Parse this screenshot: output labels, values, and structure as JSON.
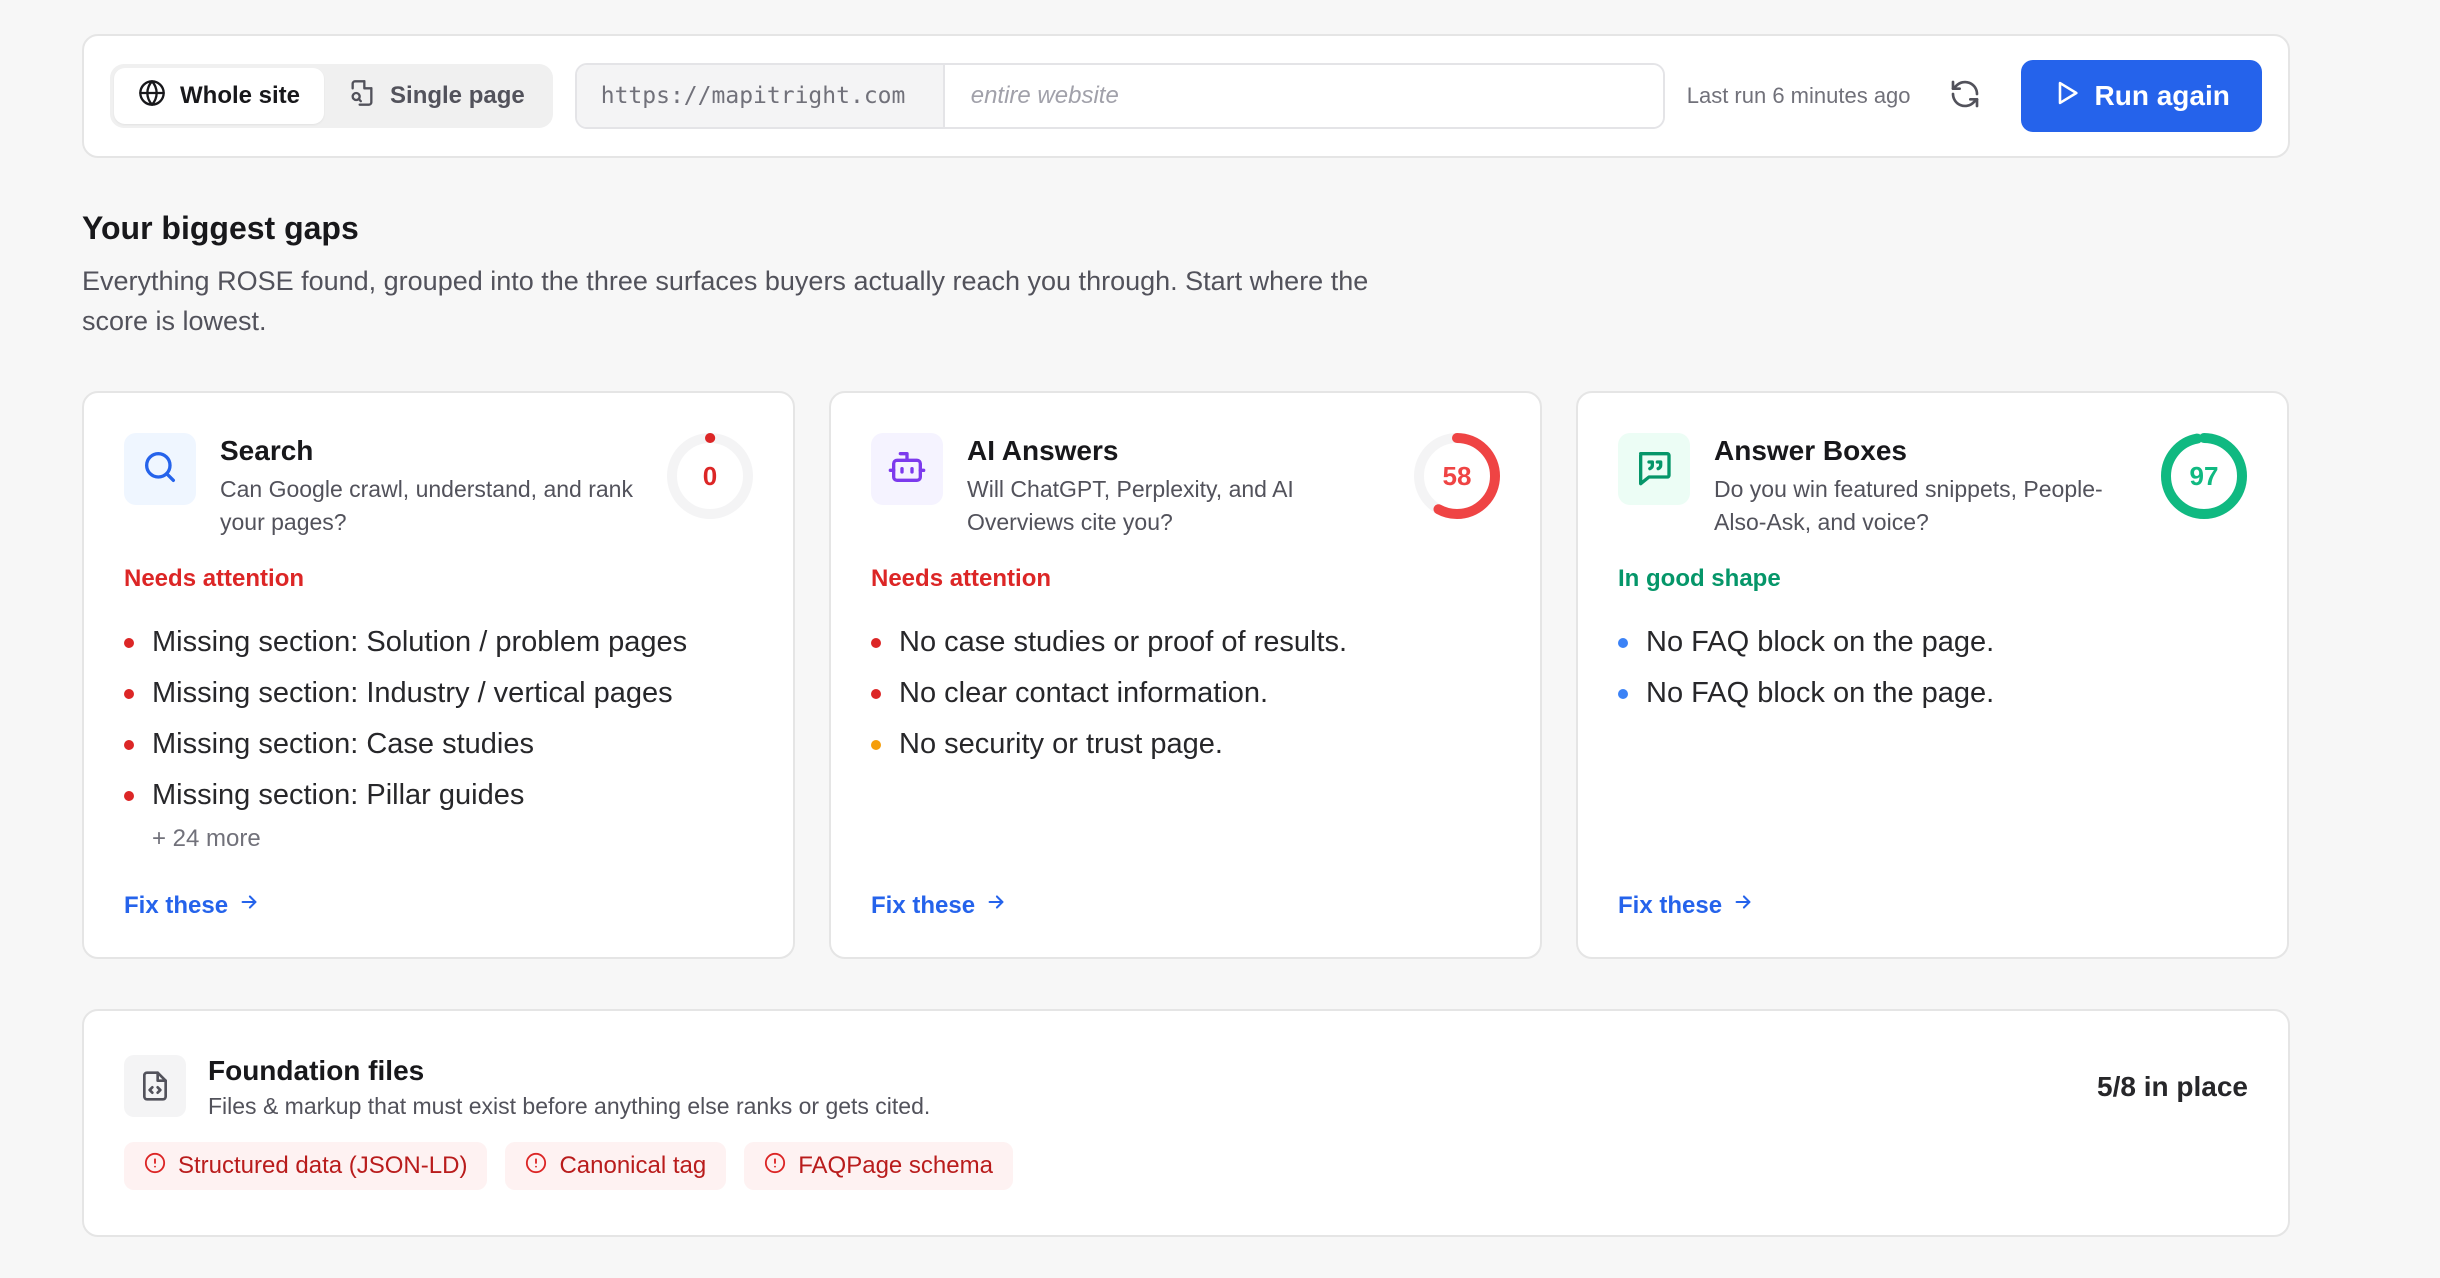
{
  "toolbar": {
    "scope_tabs": [
      {
        "label": "Whole site",
        "icon": "globe-icon",
        "active": true
      },
      {
        "label": "Single page",
        "icon": "file-search-icon",
        "active": false
      }
    ],
    "url_prefix": "https://mapitright.com",
    "url_placeholder": "entire website",
    "last_run": "Last run 6 minutes ago",
    "run_label": "Run again"
  },
  "gaps": {
    "title": "Your biggest gaps",
    "subtitle": "Everything ROSE found, grouped into the three surfaces buyers actually reach you through. Start where the score is lowest."
  },
  "cards": [
    {
      "title": "Search",
      "desc": "Can Google crawl, understand, and rank your pages?",
      "icon": "search-icon",
      "score": "0",
      "score_value": 0,
      "score_color": "#dc2626",
      "status": "Needs attention",
      "status_color": "#dc2626",
      "issues": [
        {
          "text": "Missing section: Solution / problem pages",
          "color": "#dc2626"
        },
        {
          "text": "Missing section: Industry / vertical pages",
          "color": "#dc2626"
        },
        {
          "text": "Missing section: Case studies",
          "color": "#dc2626"
        },
        {
          "text": "Missing section: Pillar guides",
          "color": "#dc2626"
        }
      ],
      "more": "+ 24 more",
      "fix_label": "Fix these"
    },
    {
      "title": "AI Answers",
      "desc": "Will ChatGPT, Perplexity, and AI Overviews cite you?",
      "icon": "bot-icon",
      "score": "58",
      "score_value": 58,
      "score_color": "#ef4444",
      "status": "Needs attention",
      "status_color": "#dc2626",
      "issues": [
        {
          "text": "No case studies or proof of results.",
          "color": "#dc2626"
        },
        {
          "text": "No clear contact information.",
          "color": "#dc2626"
        },
        {
          "text": "No security or trust page.",
          "color": "#f59e0b"
        }
      ],
      "more": "",
      "fix_label": "Fix these"
    },
    {
      "title": "Answer Boxes",
      "desc": "Do you win featured snippets, People-Also-Ask, and voice?",
      "icon": "quote-message-icon",
      "score": "97",
      "score_value": 97,
      "score_color": "#10b981",
      "status": "In good shape",
      "status_color": "#059669",
      "issues": [
        {
          "text": "No FAQ block on the page.",
          "color": "#3b82f6"
        },
        {
          "text": "No FAQ block on the page.",
          "color": "#3b82f6"
        }
      ],
      "more": "",
      "fix_label": "Fix these"
    }
  ],
  "foundation": {
    "title": "Foundation files",
    "desc": "Files & markup that must exist before anything else ranks or gets cited.",
    "count": "5/8 in place",
    "missing": [
      "Structured data (JSON-LD)",
      "Canonical tag",
      "FAQPage schema"
    ]
  }
}
